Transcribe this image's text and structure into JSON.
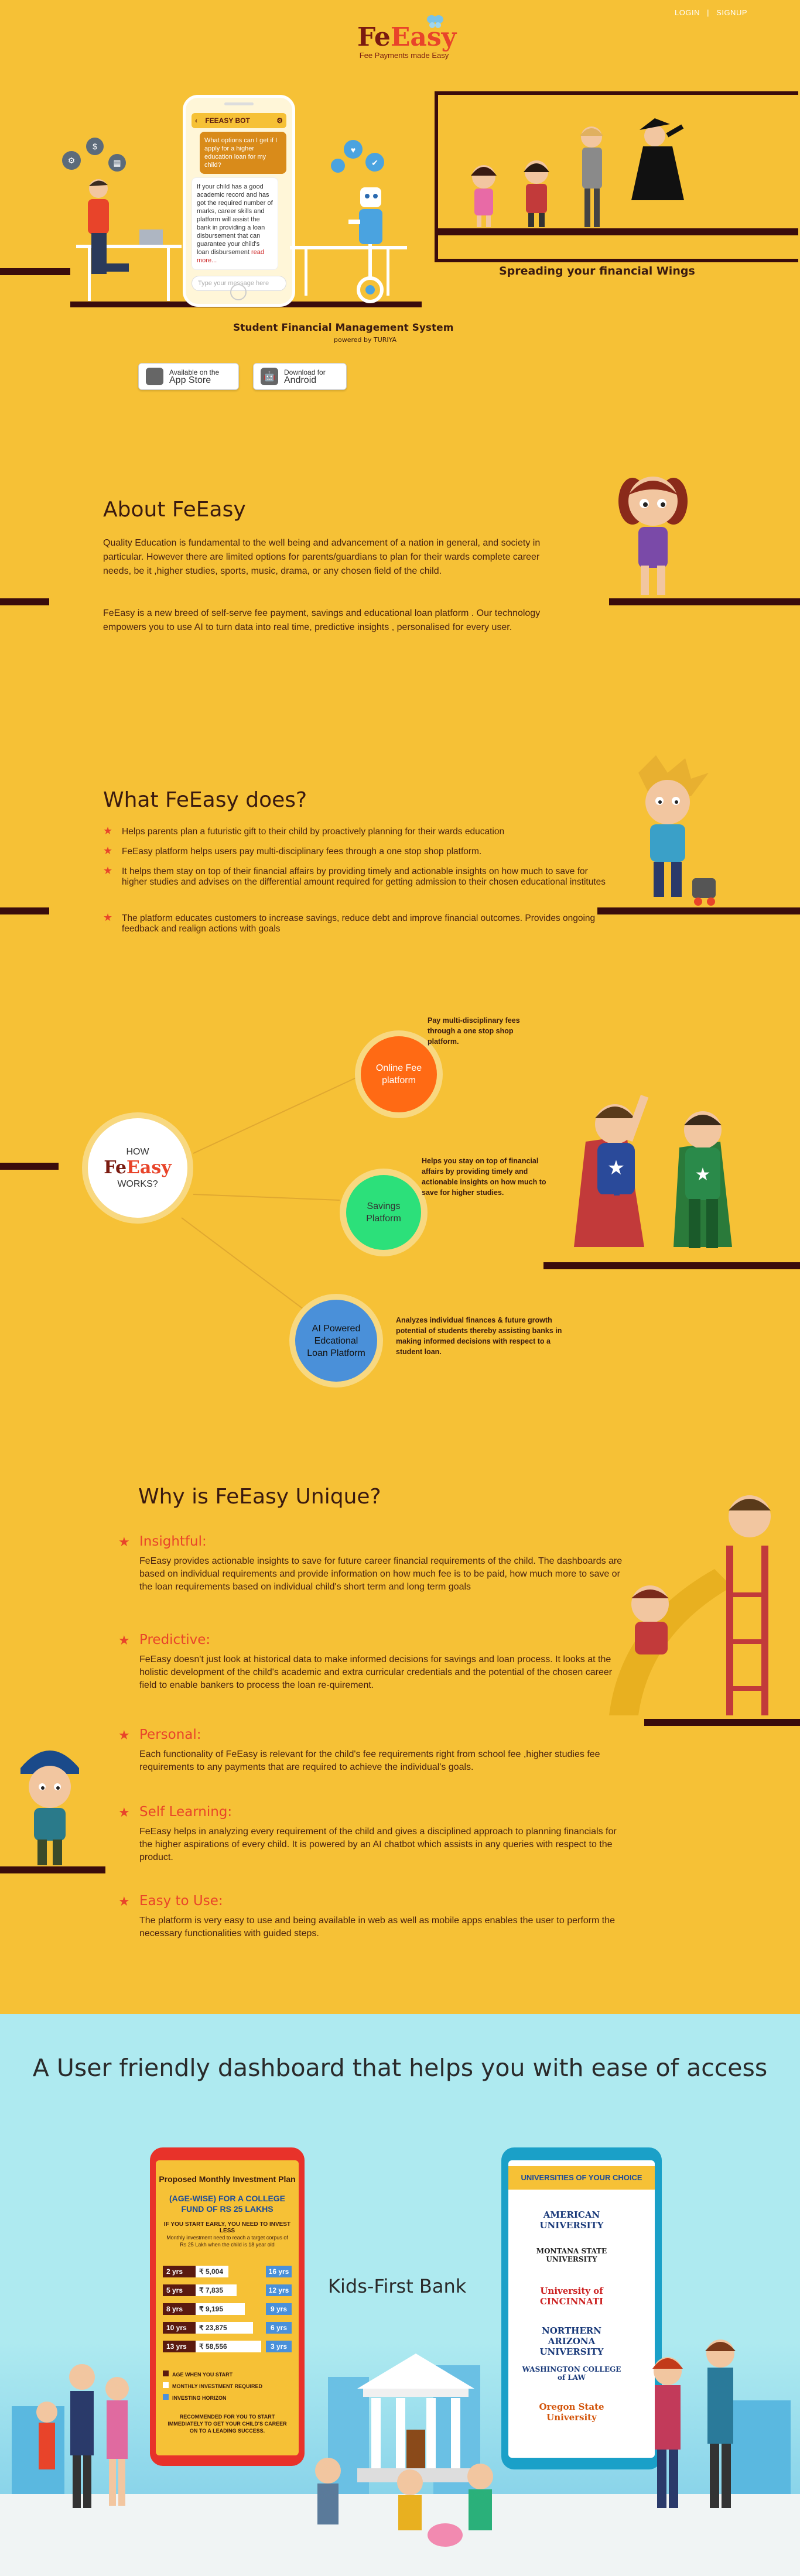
{
  "nav": {
    "login": "LOGIN",
    "signup": "SIGNUP"
  },
  "logo": {
    "brand_a": "Fe",
    "brand_b": "Easy",
    "tagline": "Fee Payments made Easy"
  },
  "hero": {
    "chatbot_title": "FEEASY BOT",
    "bubble_user": "What options can I get if I apply for a higher education loan for my child?",
    "bubble_bot": "If your child has a good academic record and has got the required number of marks, career skills and platform will assist the bank in providing a loan disbursement that can guarantee your child's loan disbursement",
    "bubble_more": "read more...",
    "type_placeholder": "Type your message here",
    "system_title": "Student Financial Management System",
    "powered_by": "powered by TURIYA",
    "wings_caption": "Spreading your financial Wings",
    "appstore_small": "Available on the",
    "appstore_big": "App Store",
    "android_small": "Download for",
    "android_big": "Android"
  },
  "about": {
    "title": "About FeEasy",
    "p1": "Quality Education is fundamental to the well being and advancement of a nation in general, and society in particular.  However there are limited options for parents/guardians to plan for their wards complete career needs, be it ,higher studies, sports,  music, drama, or any chosen field of the child.",
    "p2": "FeEasy is a new breed of  self-serve fee payment, savings and educational loan platform . Our technology empowers  you to use AI to turn data into real time, predictive insights , personalised for every user."
  },
  "does": {
    "title": "What FeEasy does?",
    "items": [
      "Helps parents plan a futuristic gift to their child by proactively planning for their wards education",
      "FeEasy platform helps users  pay multi-disciplinary  fees through a one stop shop  platform.",
      "It helps them stay on top of their financial affairs by providing timely and actionable insights on how much to save for higher studies and advises on the differential amount required for getting admission to their chosen educational institutes",
      "The platform educates customers to increase savings, reduce debt and improve financial  outcomes. Provides ongoing feedback and realign actions with goals"
    ]
  },
  "how": {
    "top": "HOW",
    "brand_a": "Fe",
    "brand_b": "Easy",
    "bottom": "WORKS?",
    "c1": "Online Fee platform",
    "c1_note": "Pay multi-disciplinary fees through a one stop shop  platform.",
    "c2": "Savings Platform",
    "c2_note": "Helps you stay on top of financial affairs by providing timely and actionable insights on how much to save for higher studies.",
    "c3": "AI Powered Edcational Loan Platform",
    "c3_note": "Analyzes individual finances &  future growth potential of students  thereby assisting banks in making informed decisions with respect to a student loan."
  },
  "unique": {
    "title": "Why is FeEasy Unique?",
    "items": [
      {
        "h": "Insightful:",
        "t": "FeEasy provides actionable insights to save for future career financial requirements of the child. The dashboards are based on individual requirements and provide information on how much fee is to be paid, how much more to save or the loan requirements based on individual child's short term and long term goals"
      },
      {
        "h": "Predictive:",
        "t": "FeEasy doesn't just look at historical data to make informed decisions for savings and loan process. It looks at the holistic development of the child's academic  and extra curricular credentials and the potential of the chosen career field to enable bankers to process the loan re-quirement."
      },
      {
        "h": "Personal:",
        "t": "Each functionality of FeEasy is relevant for the child's fee requirements right from school fee ,higher studies fee requirements to any payments that are required to achieve the individual's goals."
      },
      {
        "h": "Self Learning:",
        "t": "FeEasy helps in analyzing every requirement of the child and gives a disciplined approach to planning financials for the higher aspirations of every child. It is powered by an AI chatbot which assists in any queries with respect to the product."
      },
      {
        "h": "Easy to Use:",
        "t": "The platform is very easy to use and being available in web as well as mobile apps  enables the user to perform the necessary  functionalities  with guided steps."
      }
    ]
  },
  "dashboard": {
    "title": "A User friendly dashboard that helps you with ease of access",
    "bank_label": "Kids-First Bank",
    "plan": {
      "title": "Proposed Monthly Investment Plan",
      "subtitle": "(AGE-WISE) FOR A COLLEGE FUND OF RS 25 LAKHS",
      "note1": "IF YOU START EARLY, YOU NEED TO INVEST LESS",
      "note2": "Monthly investment need to reach a target corpus of Rs 25 Lakh when the child is 18 year old",
      "rows": [
        {
          "age": "2 yrs",
          "amount": "₹ 5,004",
          "years": "16 yrs"
        },
        {
          "age": "5 yrs",
          "amount": "₹ 7,835",
          "years": "12 yrs"
        },
        {
          "age": "8 yrs",
          "amount": "₹ 9,195",
          "years": "9 yrs"
        },
        {
          "age": "10 yrs",
          "amount": "₹ 23,875",
          "years": "6 yrs"
        },
        {
          "age": "13 yrs",
          "amount": "₹ 58,556",
          "years": "3 yrs"
        }
      ],
      "legend": [
        "AGE WHEN YOU START",
        "MONTHLY INVESTMENT REQUIRED",
        "INVESTING HORIZON"
      ],
      "footer": "RECOMMENDED FOR YOU TO START IMMEDIATELY TO GET YOUR CHILD'S CAREER ON TO A LEADING SUCCESS."
    },
    "uni": {
      "title": "UNIVERSITIES OF YOUR CHOICE",
      "list": [
        "AMERICAN UNIVERSITY",
        "MONTANA STATE UNIVERSITY",
        "University of CINCINNATI",
        "NORTHERN ARIZONA UNIVERSITY",
        "WASHINGTON COLLEGE of LAW",
        "Oregon State University"
      ]
    }
  }
}
